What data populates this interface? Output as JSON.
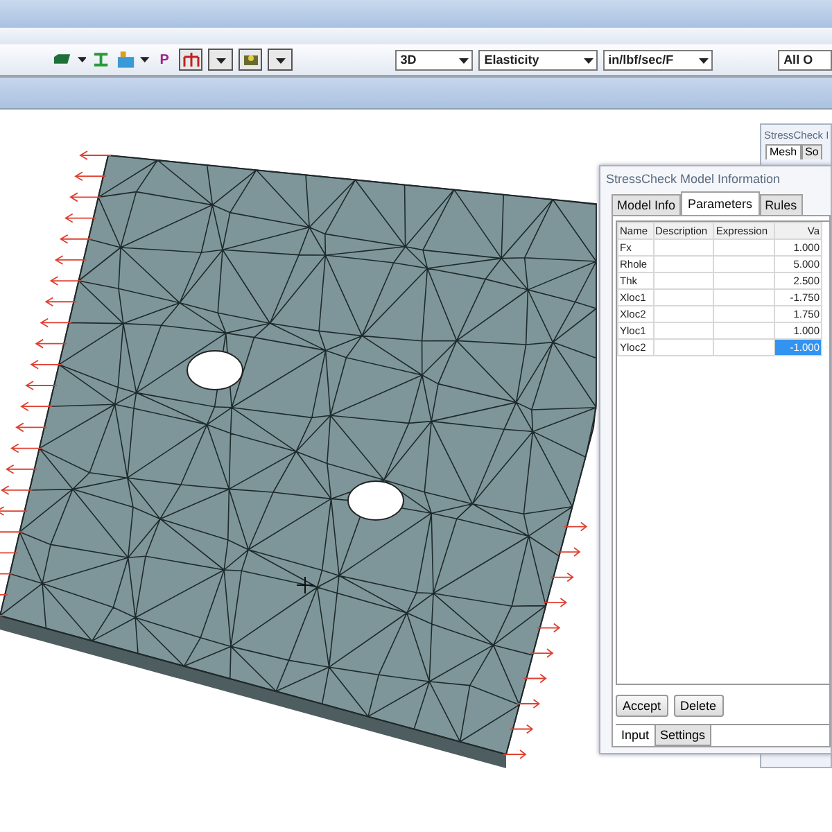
{
  "toolbar": {
    "letter_tool": "P",
    "dropdowns": [
      {
        "value": "3D"
      },
      {
        "value": "Elasticity"
      },
      {
        "value": "in/lbf/sec/F"
      },
      {
        "value": "All O"
      }
    ]
  },
  "back_window": {
    "title": "StressCheck I",
    "tabs": [
      {
        "label": "Mesh",
        "selected": true
      },
      {
        "label": "So",
        "selected": false
      }
    ]
  },
  "dialog": {
    "title": "StressCheck Model Information",
    "tabs": [
      {
        "label": "Model Info",
        "selected": false
      },
      {
        "label": "Parameters",
        "selected": true
      },
      {
        "label": "Rules",
        "selected": false
      }
    ],
    "table": {
      "columns": [
        "Name",
        "Description",
        "Expression",
        "Va"
      ],
      "rows": [
        {
          "name": "Fx",
          "description": "",
          "expression": "",
          "value": "1.000",
          "selected": false
        },
        {
          "name": "Rhole",
          "description": "",
          "expression": "",
          "value": "5.000",
          "selected": false
        },
        {
          "name": "Thk",
          "description": "",
          "expression": "",
          "value": "2.500",
          "selected": false
        },
        {
          "name": "Xloc1",
          "description": "",
          "expression": "",
          "value": "-1.750",
          "selected": false
        },
        {
          "name": "Xloc2",
          "description": "",
          "expression": "",
          "value": "1.750",
          "selected": false
        },
        {
          "name": "Yloc1",
          "description": "",
          "expression": "",
          "value": "1.000",
          "selected": false
        },
        {
          "name": "Yloc2",
          "description": "",
          "expression": "",
          "value": "-1.000",
          "selected": true
        }
      ]
    },
    "buttons": [
      "Accept",
      "Delete"
    ],
    "bottom_tabs": [
      {
        "label": "Input",
        "selected": true
      },
      {
        "label": "Settings",
        "selected": false
      }
    ]
  }
}
